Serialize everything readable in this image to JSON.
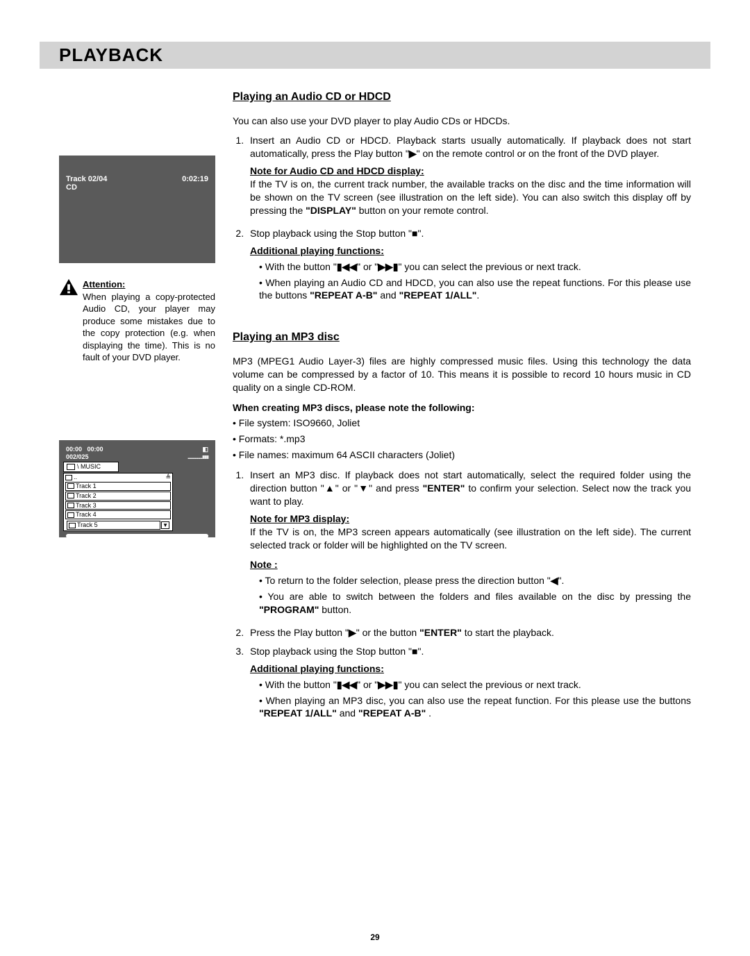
{
  "title": "PLAYBACK",
  "pageNumber": "29",
  "cd": {
    "track": "Track 02/04",
    "time": "0:02:19",
    "label": "CD"
  },
  "attention": {
    "heading": "Attention:",
    "text": "When playing a copy-protected Audio CD, your player may produce some mistakes due to the copy protection (e.g. when displaying the time). This is no fault of your DVD player."
  },
  "mp3": {
    "time1": "00:00",
    "time2": "00:00",
    "count": "002/025",
    "icon": "◧",
    "bars": "..............ıııııı",
    "folder": "\\ MUSIC",
    "up": "..",
    "tracks": [
      "Track 1",
      "Track 2",
      "Track 3",
      "Track 4",
      "Track 5"
    ]
  },
  "s1": {
    "heading": "Playing an Audio CD or HDCD",
    "intro": "You can also use your DVD player to play Audio CDs or HDCDs.",
    "step1a": "Insert an Audio CD or HDCD. Playback starts usually automatically. If playback does not start automatically, press the Play button \"",
    "play": "▶",
    "step1b": "\" on the remote control or on the front of the DVD player.",
    "noteHead": "Note for Audio CD and HDCD display:",
    "noteBody1": "If the TV is on, the current track number, the available tracks on the disc and the time information will be shown on the TV screen (see illustration on the left side). You can also switch this display off by pressing the ",
    "displayBtn": "\"DISPLAY\"",
    "noteBody2": " button on your remote control.",
    "step2a": "Stop playback using the Stop button \"",
    "stop": "■",
    "step2b": "\".",
    "addHead": "Additional playing functions:",
    "b1a": "With the button \"",
    "prev": "▮◀◀",
    "b1b": "\" or \"",
    "next": "▶▶▮",
    "b1c": "\" you can select the previous or next track.",
    "b2a": "When playing an Audio CD and HDCD, you can also use the repeat functions. For this please use the buttons ",
    "rab": "\"REPEAT A-B\"",
    "b2b": " and ",
    "r1all": "\"REPEAT 1/ALL\"",
    "b2c": "."
  },
  "s2": {
    "heading": "Playing an MP3 disc",
    "intro": "MP3 (MPEG1 Audio Layer-3) files are highly compressed music files. Using this technology the data volume can be compressed by a factor of 10. This means it is possible to record 10 hours music in CD quality on a single CD-ROM.",
    "createHead": "When creating MP3 discs, please note the following:",
    "c1": "File system: ISO9660, Joliet",
    "c2": "Formats: *.mp3",
    "c3": "File names: maximum 64 ASCII characters (Joliet)",
    "step1a": "Insert an MP3 disc. If playback does not start automatically, select the required folder using the direction button \"",
    "up": "▲",
    "step1b": "\" or \"",
    "down": "▼",
    "step1c": "\" and press ",
    "enter": "\"ENTER\"",
    "step1d": " to confirm your selection. Select now the track you want to play.",
    "noteMp3Head": "Note for MP3 display:",
    "noteMp3Body": "If the TV is on, the MP3 screen appears automatically (see illustration on the left side). The current selected track or folder will be highlighted on the TV screen.",
    "noteHead2": "Note :",
    "n1a": "To return to the folder selection, please press the direction button \"",
    "left": "◀",
    "n1b": "\".",
    "n2a": "You are able to switch between the folders and files available on the disc by pressing the ",
    "program": "\"PROGRAM\"",
    "n2b": " button.",
    "step2a": "Press the Play button \"",
    "play": "▶",
    "step2b": "\" or the button ",
    "enter2": "\"ENTER\"",
    "step2c": " to start the playback.",
    "step3a": "Stop playback using the Stop button \"",
    "stop": "■",
    "step3b": "\".",
    "addHead2": "Additional playing functions:",
    "ab1a": "With the button \"",
    "prev2": "▮◀◀",
    "ab1b": "\" or \"",
    "next2": "▶▶▮",
    "ab1c": "\" you can select the previous or next track.",
    "ab2a": "When playing an MP3 disc, you can also use the repeat function. For this please use the buttons ",
    "r1all2": "\"REPEAT 1/ALL\"",
    "ab2b": " and ",
    "rab2": "\"REPEAT A-B\"",
    "ab2c": " ."
  }
}
